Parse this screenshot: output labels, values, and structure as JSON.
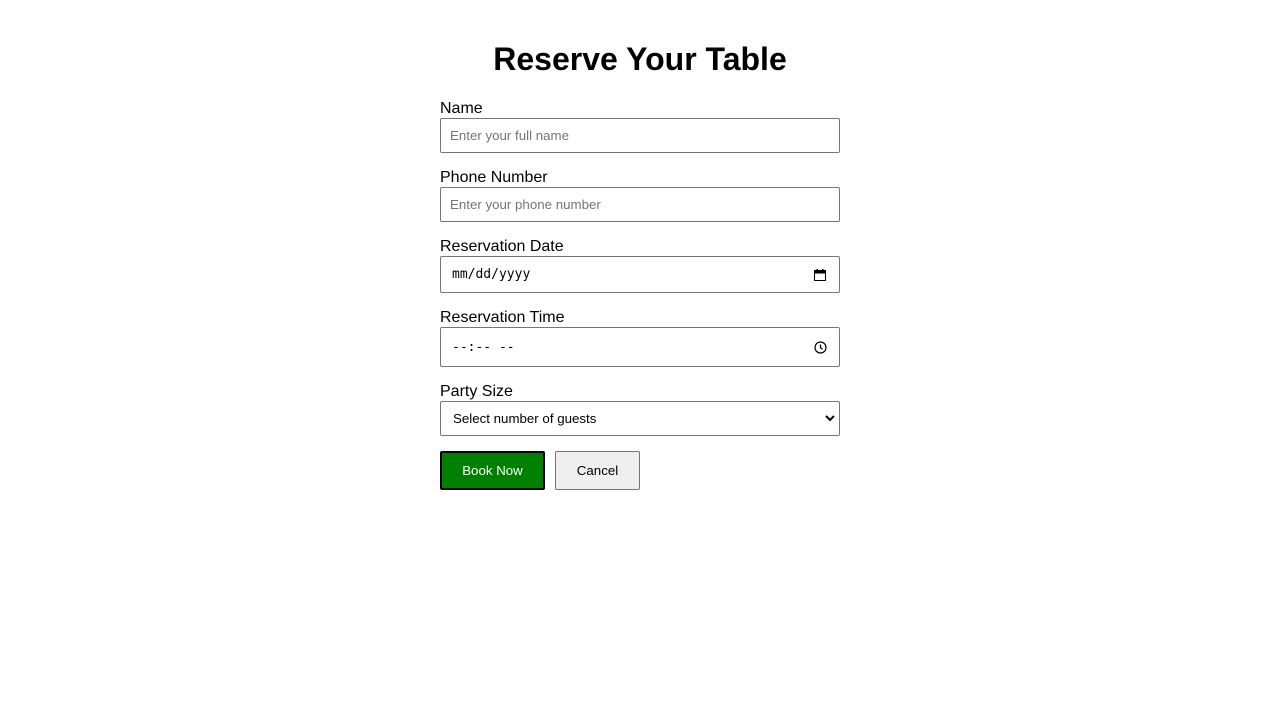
{
  "page": {
    "title": "Reserve Your Table"
  },
  "form": {
    "name": {
      "label": "Name",
      "placeholder": "Enter your full name",
      "value": ""
    },
    "phone": {
      "label": "Phone Number",
      "placeholder": "Enter your phone number",
      "value": ""
    },
    "date": {
      "label": "Reservation Date",
      "display": "mm/dd/yyyy",
      "icon": "calendar-icon"
    },
    "time": {
      "label": "Reservation Time",
      "display": "--:-- --",
      "icon": "clock-icon"
    },
    "party_size": {
      "label": "Party Size",
      "selected": "Select number of guests",
      "icon": "chevron-down-icon"
    }
  },
  "buttons": {
    "book_label": "Book Now",
    "cancel_label": "Cancel"
  },
  "colors": {
    "primary_button": "#008000",
    "secondary_button": "#efefef",
    "field_border": "#767676"
  }
}
